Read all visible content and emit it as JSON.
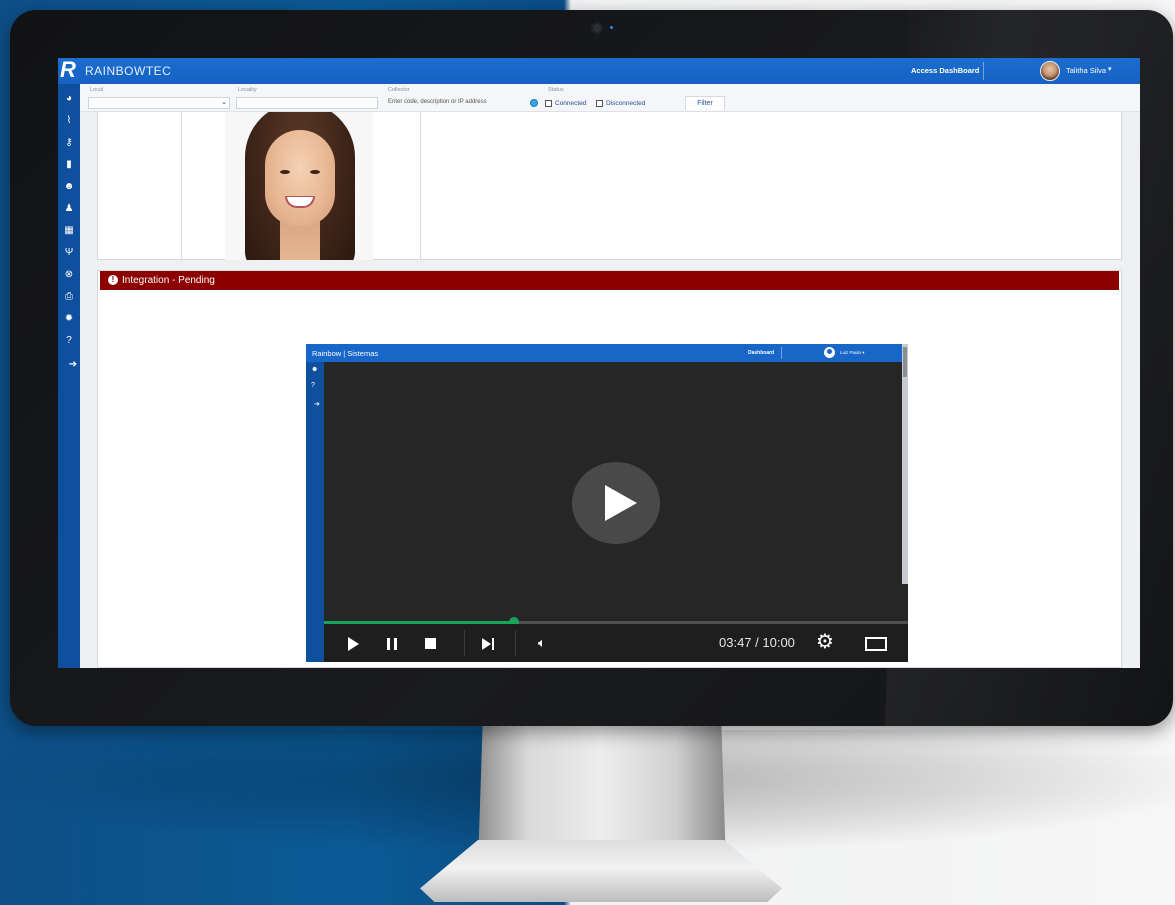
{
  "app": {
    "brand": "RAINBOWTEC",
    "logo_letter": "R",
    "access_dashboard": "Access DashBoard",
    "user_name": "Talitha Silva",
    "user_caret": "▾"
  },
  "sidebar_icons": [
    "dashboard-icon",
    "chart-icon",
    "key-icon",
    "document-icon",
    "users-icon",
    "user-icon",
    "calendar-icon",
    "restaurant-icon",
    "close-circle-icon",
    "print-icon",
    "gear-icon",
    "help-icon",
    "arrow-right-circle-icon"
  ],
  "filters": {
    "local_label": "Local",
    "locality_label": "Locality",
    "collector_label": "Collector",
    "collector_placeholder": "Enter code, description or IP address",
    "status_label": "Status",
    "connected_label": "Connected",
    "disconnected_label": "Disconnected",
    "filter_button": "Filter"
  },
  "integration": {
    "title": "Integration - Pending"
  },
  "video": {
    "brand": "Rainbow | Sistemas",
    "dashboard": "Dashboard",
    "user": "Luiz Paulo ▾",
    "time": "03:47 / 10:00",
    "progress": 0.325
  },
  "colors": {
    "topbar": "#1766c8",
    "sidebar": "#0e4f9e",
    "integration_header": "#8d0000",
    "progress": "#17a35a"
  }
}
